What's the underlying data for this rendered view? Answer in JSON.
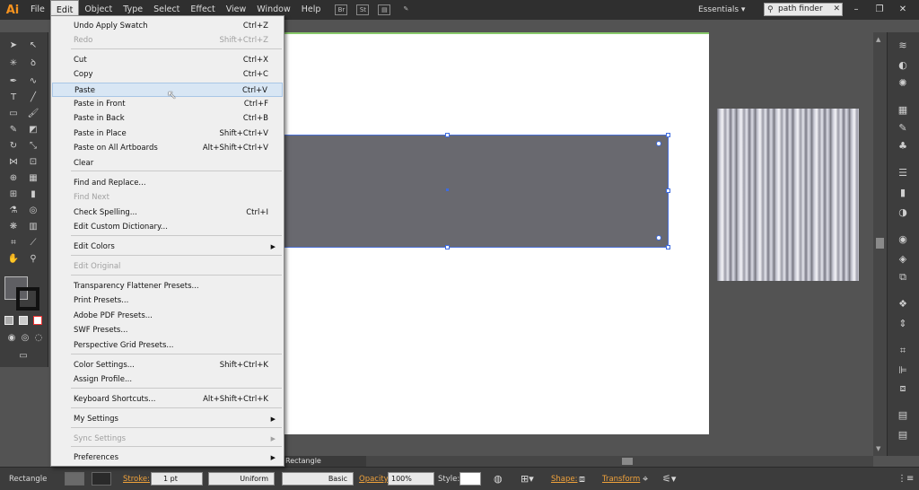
{
  "app": {
    "logo": "Ai",
    "menus": [
      "File",
      "Edit",
      "Object",
      "Type",
      "Select",
      "Effect",
      "View",
      "Window",
      "Help"
    ],
    "workspace": "Essentials",
    "search_value": "path finder"
  },
  "edit_menu": {
    "items": [
      {
        "label": "Undo Apply Swatch",
        "shortcut": "Ctrl+Z",
        "disabled": false
      },
      {
        "label": "Redo",
        "shortcut": "Shift+Ctrl+Z",
        "disabled": true
      },
      {
        "label": "Cut",
        "shortcut": "Ctrl+X",
        "disabled": false
      },
      {
        "label": "Copy",
        "shortcut": "Ctrl+C",
        "disabled": false
      },
      {
        "label": "Paste",
        "shortcut": "Ctrl+V",
        "disabled": false,
        "highlighted": true
      },
      {
        "label": "Paste in Front",
        "shortcut": "Ctrl+F",
        "disabled": false
      },
      {
        "label": "Paste in Back",
        "shortcut": "Ctrl+B",
        "disabled": false
      },
      {
        "label": "Paste in Place",
        "shortcut": "Shift+Ctrl+V",
        "disabled": false
      },
      {
        "label": "Paste on All Artboards",
        "shortcut": "Alt+Shift+Ctrl+V",
        "disabled": false
      },
      {
        "label": "Clear",
        "shortcut": "",
        "disabled": false
      },
      {
        "label": "Find and Replace...",
        "shortcut": "",
        "disabled": false
      },
      {
        "label": "Find Next",
        "shortcut": "",
        "disabled": true
      },
      {
        "label": "Check Spelling...",
        "shortcut": "Ctrl+I",
        "disabled": false
      },
      {
        "label": "Edit Custom Dictionary...",
        "shortcut": "",
        "disabled": false
      },
      {
        "label": "Edit Colors",
        "shortcut": "",
        "disabled": false,
        "submenu": true
      },
      {
        "label": "Edit Original",
        "shortcut": "",
        "disabled": true
      },
      {
        "label": "Transparency Flattener Presets...",
        "shortcut": "",
        "disabled": false
      },
      {
        "label": "Print Presets...",
        "shortcut": "",
        "disabled": false
      },
      {
        "label": "Adobe PDF Presets...",
        "shortcut": "",
        "disabled": false
      },
      {
        "label": "SWF Presets...",
        "shortcut": "",
        "disabled": false
      },
      {
        "label": "Perspective Grid Presets...",
        "shortcut": "",
        "disabled": false
      },
      {
        "label": "Color Settings...",
        "shortcut": "Shift+Ctrl+K",
        "disabled": false
      },
      {
        "label": "Assign Profile...",
        "shortcut": "",
        "disabled": false
      },
      {
        "label": "Keyboard Shortcuts...",
        "shortcut": "Alt+Shift+Ctrl+K",
        "disabled": false
      },
      {
        "label": "My Settings",
        "shortcut": "",
        "disabled": false,
        "submenu": true
      },
      {
        "label": "Sync Settings",
        "shortcut": "",
        "disabled": true,
        "submenu": true
      },
      {
        "label": "Preferences",
        "shortcut": "",
        "disabled": false,
        "submenu": true
      }
    ]
  },
  "canvas": {
    "scroll_label": "Rectangle"
  },
  "control_bar": {
    "selection": "Rectangle",
    "stroke_label": "Stroke:",
    "stroke_weight": "1 pt",
    "profile": "Uniform",
    "brush": "Basic",
    "opacity_label": "Opacity:",
    "opacity_value": "100%",
    "style_label": "Style:",
    "shape_label": "Shape:",
    "transform_label": "Transform"
  },
  "colors": {
    "accent_orange": "#f0a23b",
    "rect_fill": "#69696f",
    "selection_blue": "#3d6be0"
  }
}
